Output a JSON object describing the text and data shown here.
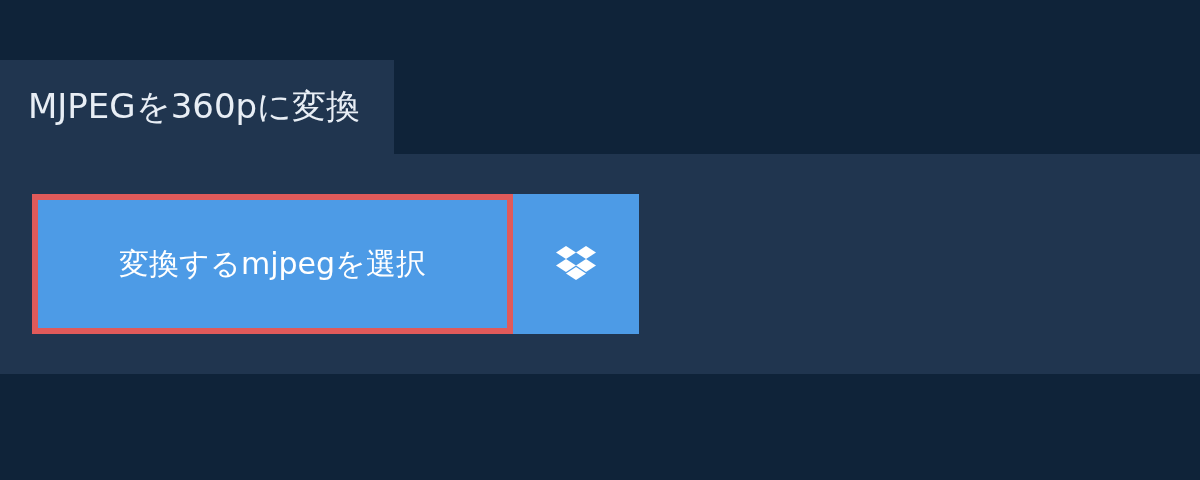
{
  "tab": {
    "title": "MJPEGを360pに変換"
  },
  "upload": {
    "label": "変換するmjpegを選択",
    "focused": true
  }
}
